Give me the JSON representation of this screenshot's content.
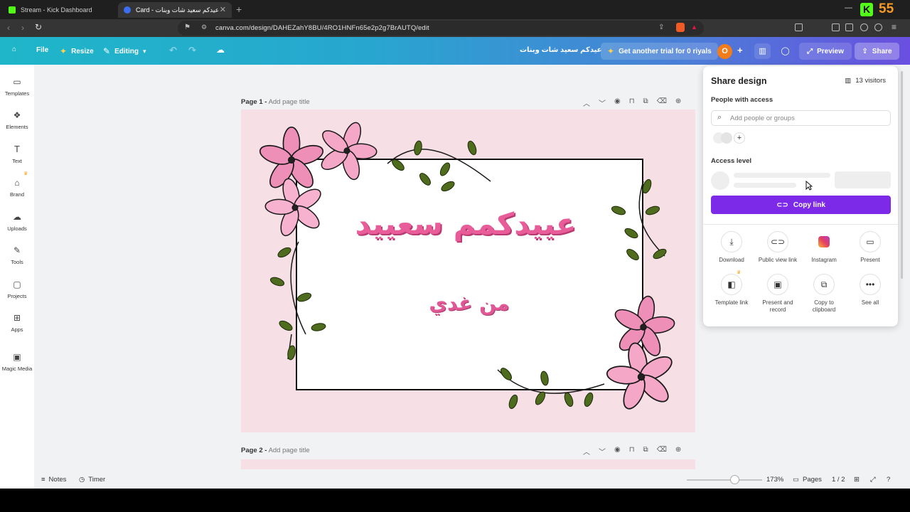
{
  "browser": {
    "tabs": [
      {
        "label": "Stream - Kick Dashboard",
        "close": "✕"
      },
      {
        "label": "Card - عيدكم سعيد شات وبنات",
        "close": "✕"
      }
    ],
    "new_tab": "+",
    "url": "canva.com/design/DAHEZahY8BU/4RO1HNFn65e2p2g7BrAUTQ/edit",
    "kick_count": "55",
    "kick_logo": "K"
  },
  "toolbar": {
    "file": "File",
    "resize": "Resize",
    "editing": "Editing",
    "design_title": "عيدكم سعيد شات وبنات",
    "trial": "Get another trial for 0 riyals",
    "avatar_initial": "O",
    "preview": "Preview",
    "share": "Share",
    "colors": {
      "gradient_start": "#1fb6c9",
      "gradient_end": "#6a4fe0"
    }
  },
  "rail": [
    {
      "label": "Templates",
      "icon": "templates-icon"
    },
    {
      "label": "Elements",
      "icon": "elements-icon"
    },
    {
      "label": "Text",
      "icon": "text-icon"
    },
    {
      "label": "Brand",
      "icon": "brand-icon"
    },
    {
      "label": "Uploads",
      "icon": "uploads-icon"
    },
    {
      "label": "Tools",
      "icon": "tools-icon"
    },
    {
      "label": "Projects",
      "icon": "projects-icon"
    },
    {
      "label": "Apps",
      "icon": "apps-icon"
    },
    {
      "label": "Magic Media",
      "icon": "magic-media-icon"
    }
  ],
  "pages": [
    {
      "label": "Page 1 -",
      "placeholder": "Add page title"
    },
    {
      "label": "Page 2 -",
      "placeholder": "Add page title"
    }
  ],
  "card": {
    "title": "عييدكمم سعييد",
    "subtitle": "من غدي",
    "colors": {
      "background": "#f7dfe6",
      "text": "#e85c99",
      "frame": "#111111"
    }
  },
  "bottom": {
    "notes": "Notes",
    "timer": "Timer",
    "zoom": "173%",
    "pages": "Pages",
    "page_count": "1 / 2",
    "zoom_slider_fraction": 0.63
  },
  "share_panel": {
    "title": "Share design",
    "visitors": "13 visitors",
    "people_label": "People with access",
    "search_placeholder": "Add people or groups",
    "access_label": "Access level",
    "copy_link": "Copy link",
    "accent": "#7d2ae8",
    "options": [
      {
        "label": "Download",
        "icon": "download-icon"
      },
      {
        "label": "Public view link",
        "icon": "link-icon"
      },
      {
        "label": "Instagram",
        "icon": "instagram-icon"
      },
      {
        "label": "Present",
        "icon": "present-icon"
      },
      {
        "label": "Template link",
        "icon": "template-link-icon"
      },
      {
        "label": "Present and record",
        "icon": "record-icon"
      },
      {
        "label": "Copy to clipboard",
        "icon": "clipboard-icon"
      },
      {
        "label": "See all",
        "icon": "more-icon"
      }
    ]
  }
}
